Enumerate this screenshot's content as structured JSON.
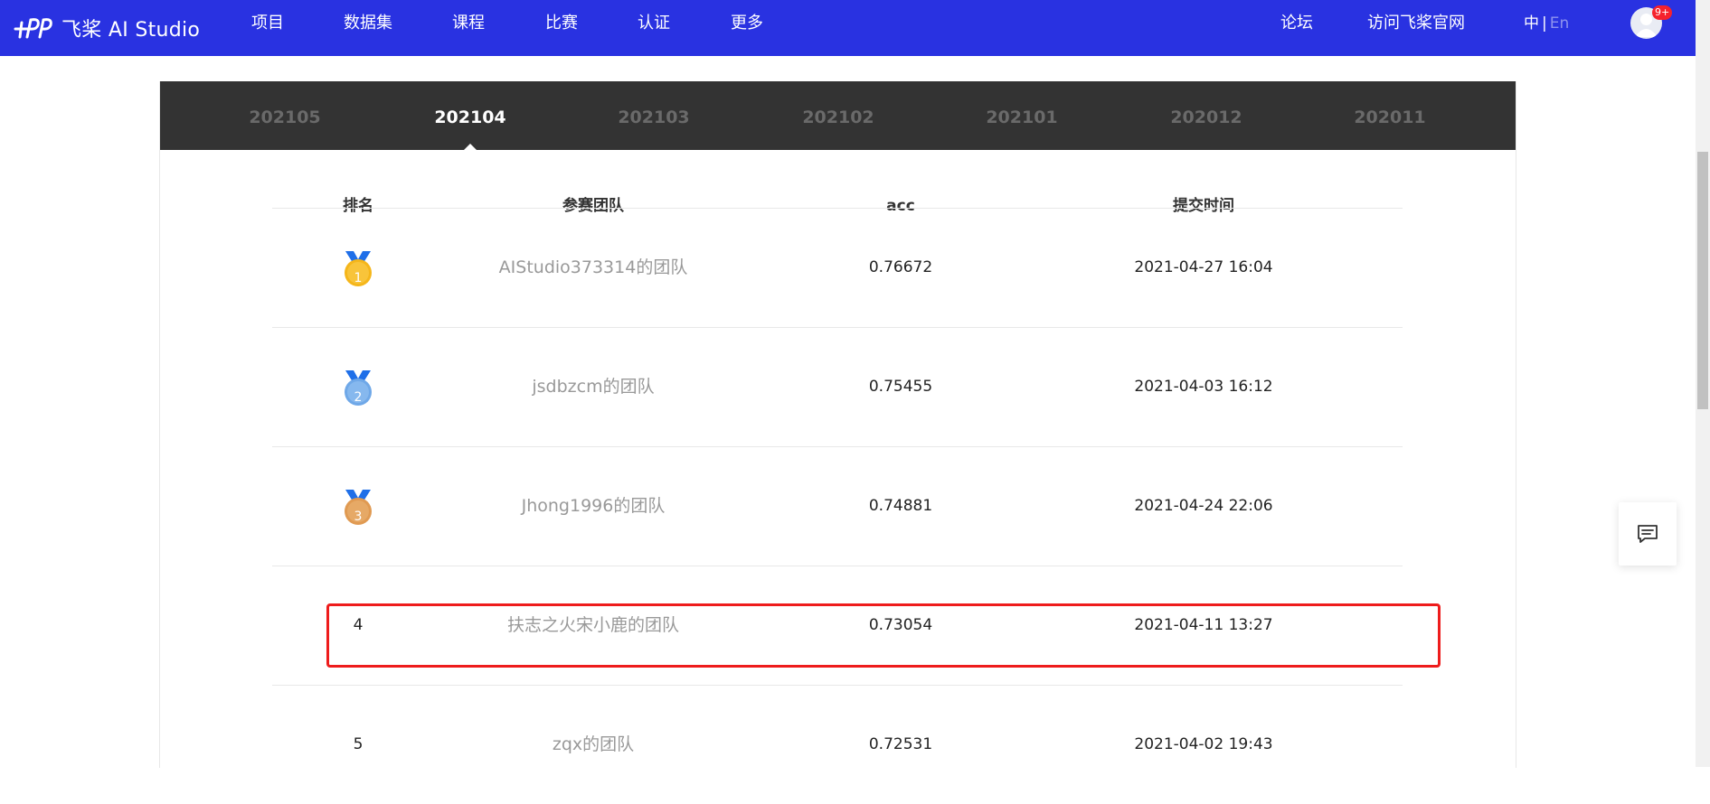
{
  "nav": {
    "logo_text": "飞桨 AI Studio",
    "items": [
      "项目",
      "数据集",
      "课程",
      "比赛",
      "认证",
      "更多"
    ],
    "right_links": [
      "论坛",
      "访问飞桨官网"
    ],
    "lang_zh": "中",
    "lang_sep": "|",
    "lang_en": "En",
    "notification_badge": "9+"
  },
  "leaderboard": {
    "tabs": [
      "202105",
      "202104",
      "202103",
      "202102",
      "202101",
      "202012",
      "202011"
    ],
    "active_tab": "202104",
    "columns": [
      "排名",
      "参赛团队",
      "acc",
      "提交时间"
    ],
    "rows": [
      {
        "rank": "1",
        "team": "AIStudio373314的团队",
        "acc": "0.76672",
        "time": "2021-04-27 16:04",
        "medal": "gold"
      },
      {
        "rank": "2",
        "team": "jsdbzcm的团队",
        "acc": "0.75455",
        "time": "2021-04-03 16:12",
        "medal": "silver"
      },
      {
        "rank": "3",
        "team": "Jhong1996的团队",
        "acc": "0.74881",
        "time": "2021-04-24 22:06",
        "medal": "bronze"
      },
      {
        "rank": "4",
        "team": "扶志之火宋小鹿的团队",
        "acc": "0.73054",
        "time": "2021-04-11 13:27",
        "medal": ""
      },
      {
        "rank": "5",
        "team": "zqx的团队",
        "acc": "0.72531",
        "time": "2021-04-02 19:43",
        "medal": ""
      }
    ]
  },
  "colors": {
    "nav_bg": "#2932e1",
    "tab_bar_bg": "#333333",
    "highlight_border": "#ee1c1c",
    "gold": "#f5b61a",
    "silver": "#6fa8e8",
    "bronze": "#e09a52",
    "ribbon": "#1f6fe8"
  },
  "icons": {
    "logo": "paddlepaddle-logo-icon",
    "avatar": "user-avatar-icon",
    "feedback": "chat-feedback-icon",
    "medal": "medal-icon"
  }
}
